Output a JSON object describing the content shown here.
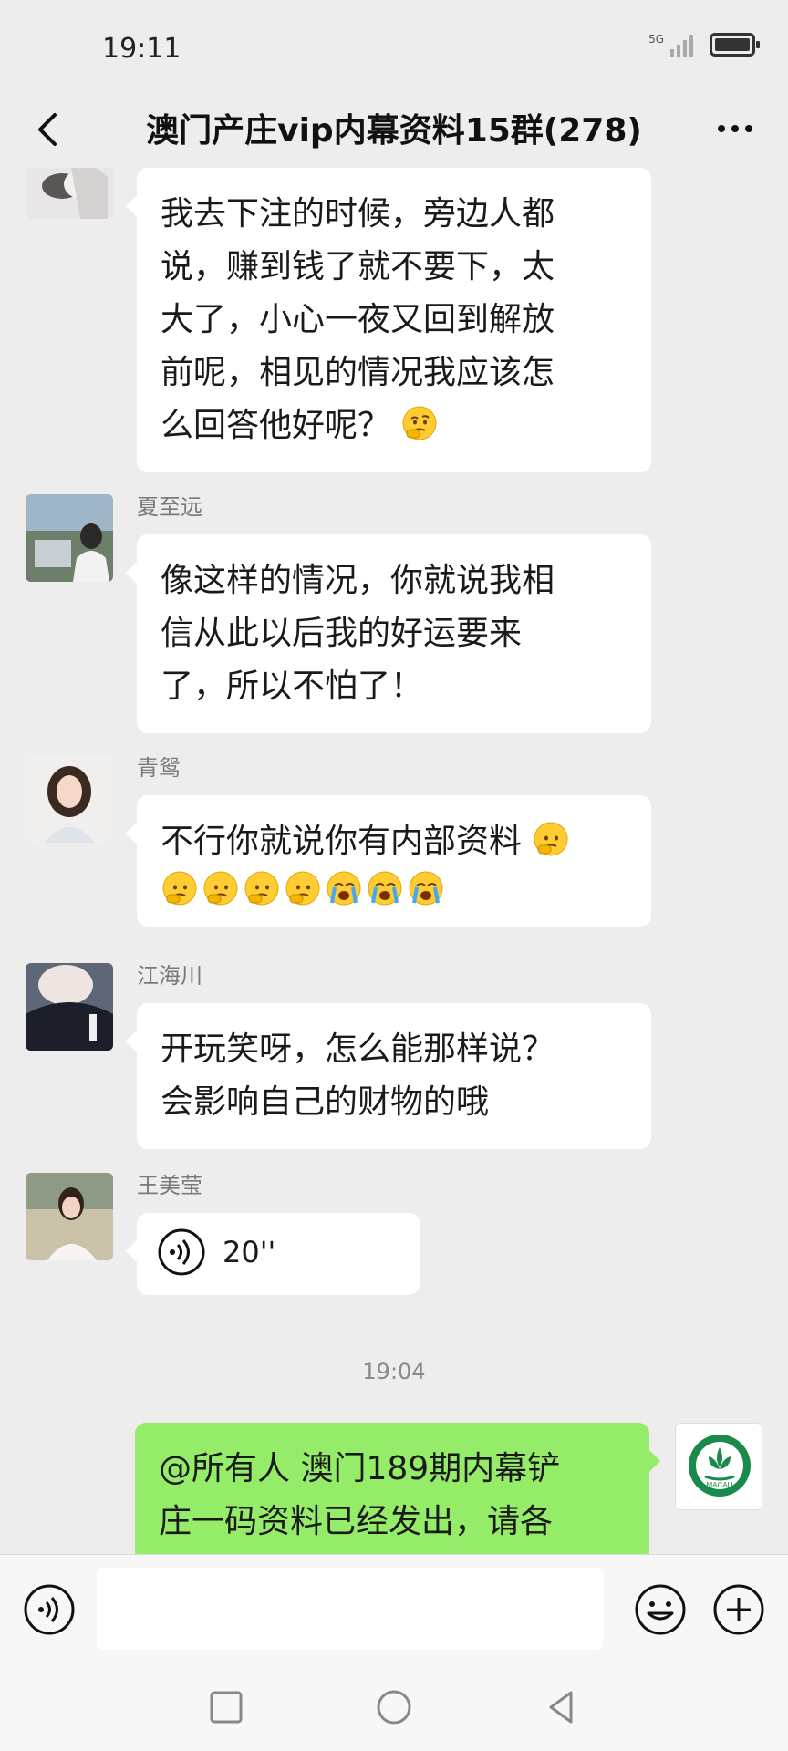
{
  "status_bar": {
    "time": "19:11",
    "network": "5G"
  },
  "header": {
    "title": "澳门产庄vip内幕资料15群(278)"
  },
  "messages": [
    {
      "sender": "",
      "text": [
        "我去下注的时候，旁边人都",
        "说，赚到钱了就不要下，太",
        "大了，小心一夜又回到解放",
        "前呢，相见的情况我应该怎",
        "么回答他好呢？"
      ],
      "emoji": [
        "thinking-face"
      ]
    },
    {
      "sender": "夏至远",
      "text": [
        "像这样的情况，你就说我相",
        "信从此以后我的好运要来",
        "了，所以不怕了！"
      ]
    },
    {
      "sender": "青鸳",
      "text": [
        "不行你就说你有内部资料"
      ],
      "emoji_line": [
        "thinking-face",
        "thinking-face",
        "thinking-face",
        "thinking-face",
        "loudly-crying-face",
        "loudly-crying-face",
        "loudly-crying-face"
      ]
    },
    {
      "sender": "江海川",
      "text": [
        "开玩笑呀，怎么能那样说？",
        "会影响自己的财物的哦"
      ]
    },
    {
      "sender": "王美莹",
      "voice_duration": "20''"
    }
  ],
  "time_divider": "19:04",
  "my_message": {
    "text": [
      "@所有人 澳门189期内幕铲",
      "庄一码资料已经发出，请各"
    ],
    "avatar_text": "MACAU"
  },
  "input_bar": {
    "placeholder": ""
  },
  "colors": {
    "background": "#ededed",
    "my_bubble": "#95ec69",
    "their_bubble": "#ffffff"
  }
}
